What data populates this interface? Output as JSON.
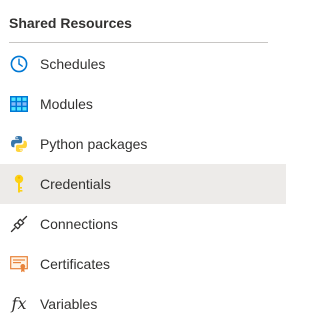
{
  "section": {
    "title": "Shared Resources"
  },
  "items": [
    {
      "label": "Schedules",
      "icon": "clock-icon",
      "selected": false
    },
    {
      "label": "Modules",
      "icon": "modules-grid-icon",
      "selected": false
    },
    {
      "label": "Python packages",
      "icon": "python-icon",
      "selected": false
    },
    {
      "label": "Credentials",
      "icon": "key-icon",
      "selected": true
    },
    {
      "label": "Connections",
      "icon": "plug-icon",
      "selected": false
    },
    {
      "label": "Certificates",
      "icon": "certificate-icon",
      "selected": false
    },
    {
      "label": "Variables",
      "icon": "fx-icon",
      "glyph": "fx",
      "selected": false
    }
  ],
  "colors": {
    "selected_background": "#edebe9",
    "text": "#323130",
    "divider": "#c8c6c4"
  }
}
